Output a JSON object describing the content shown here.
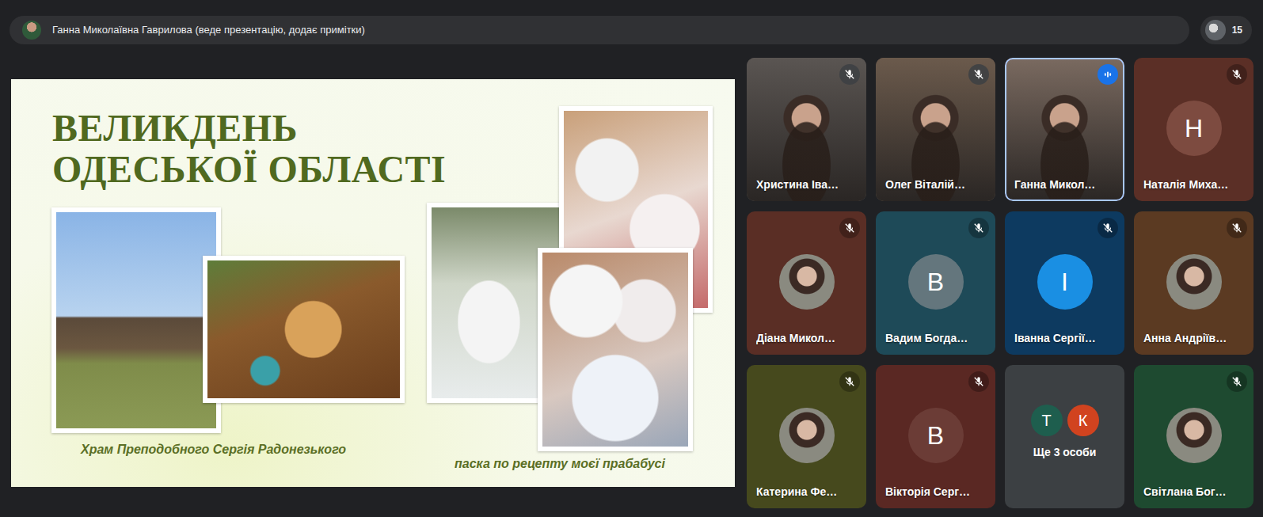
{
  "presenter_bar": {
    "text": "Ганна Миколаївна Гаврилова (веде презентацію, додає примітки)"
  },
  "participants_count": "15",
  "slide": {
    "title_lines": [
      "ВЕЛИКДЕНЬ",
      "ОДЕСЬКОЇ ОБЛАСТІ"
    ],
    "captions": [
      "Храм Преподобного Сергія Радонезького",
      "паска по рецепту моєї прабабусі"
    ]
  },
  "tiles": [
    {
      "name": "Христина Іва…",
      "kind": "video",
      "muted": true,
      "speaking": false,
      "color": "#5a5552"
    },
    {
      "name": "Олег Віталій…",
      "kind": "video",
      "muted": true,
      "speaking": false,
      "color": "#6b5a4c"
    },
    {
      "name": "Ганна Микол…",
      "kind": "video",
      "muted": false,
      "speaking": true,
      "color": "#7a6a60"
    },
    {
      "name": "Наталія Миха…",
      "kind": "letter",
      "letter": "Н",
      "avatar_color": "#7d4b40",
      "muted": true,
      "speaking": false,
      "color": "#5b2f26"
    },
    {
      "name": "Діана Микол…",
      "kind": "photo",
      "muted": true,
      "speaking": false,
      "color": "#5a2e25"
    },
    {
      "name": "Вадим Богда…",
      "kind": "letter",
      "letter": "В",
      "avatar_color": "#64767d",
      "muted": true,
      "speaking": false,
      "color": "#1e4a58"
    },
    {
      "name": "Іванна Сергії…",
      "kind": "letter",
      "letter": "І",
      "avatar_color": "#1a8fe3",
      "muted": true,
      "speaking": false,
      "color": "#0d3a60"
    },
    {
      "name": "Анна Андріїв…",
      "kind": "photo",
      "muted": true,
      "speaking": false,
      "color": "#5b3a22"
    },
    {
      "name": "Катерина Фе…",
      "kind": "photo",
      "muted": true,
      "speaking": false,
      "color": "#46491d"
    },
    {
      "name": "Вікторія Серг…",
      "kind": "letter",
      "letter": "В",
      "avatar_color": "#6b3c36",
      "muted": true,
      "speaking": false,
      "color": "#5a2823"
    },
    {
      "name": "",
      "kind": "more",
      "text": "Ще 3 особи",
      "avatars": [
        {
          "letter": "Т",
          "color": "#1e5e4e"
        },
        {
          "letter": "К",
          "color": "#d1431f"
        }
      ],
      "color": "#3c4043"
    },
    {
      "name": "Світлана Бог…",
      "kind": "photo",
      "muted": true,
      "speaking": false,
      "color": "#1e4a30"
    }
  ]
}
